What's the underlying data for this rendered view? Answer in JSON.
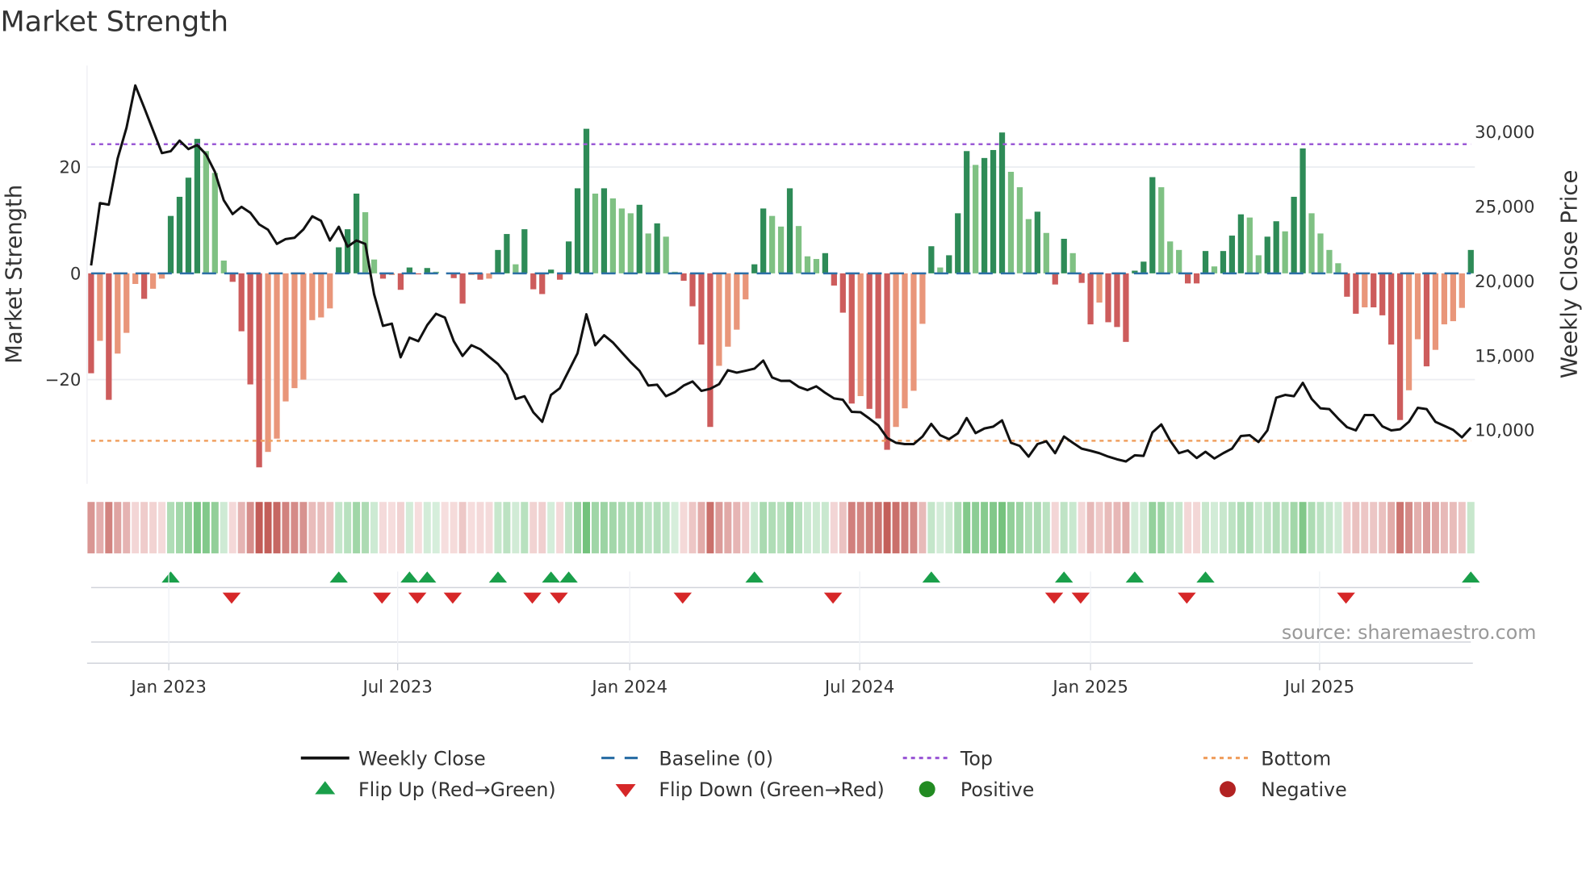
{
  "chart_data": {
    "type": "bar",
    "title": "Market Strength",
    "ylabel": "Market Strength",
    "y2label": "Weekly Close Price",
    "ylim": [
      -39.6,
      39.1
    ],
    "y2lim": [
      6400,
      34460
    ],
    "yticks": [
      {
        "value": 20,
        "label": "20"
      },
      {
        "value": 0,
        "label": "0"
      },
      {
        "value": -20,
        "label": "−20"
      }
    ],
    "y2ticks": [
      {
        "value": 30000,
        "label": "30,000"
      },
      {
        "value": 25000,
        "label": "25,000"
      },
      {
        "value": 20000,
        "label": "20,000"
      },
      {
        "value": 15000,
        "label": "15,000"
      },
      {
        "value": 10000,
        "label": "10,000"
      }
    ],
    "xticks": [
      {
        "week": 8.78,
        "label": "Jan 2023"
      },
      {
        "week": 34.66,
        "label": "Jul 2023"
      },
      {
        "week": 60.9,
        "label": "Jan 2024"
      },
      {
        "week": 86.9,
        "label": "Jul 2024"
      },
      {
        "week": 113.0,
        "label": "Jan 2025"
      },
      {
        "week": 138.9,
        "label": "Jul 2025"
      }
    ],
    "top_level": 24.3,
    "bottom_level": -31.5,
    "strength": [
      -18.8,
      -12.7,
      -23.8,
      -15.1,
      -11.2,
      -2.0,
      -4.8,
      -2.9,
      -1.0,
      10.8,
      14.4,
      18.0,
      25.3,
      23.0,
      18.9,
      2.4,
      -1.6,
      -10.9,
      -20.9,
      -36.5,
      -33.6,
      -31.1,
      -24.1,
      -21.6,
      -20.0,
      -8.8,
      -8.3,
      -6.6,
      4.9,
      8.3,
      15.0,
      11.5,
      2.6,
      -1.0,
      -0.3,
      -3.1,
      1.1,
      -0.2,
      1.0,
      0.3,
      0.0,
      -0.9,
      -5.7,
      -0.3,
      -1.2,
      -1.0,
      4.4,
      7.4,
      1.7,
      8.3,
      -3.0,
      -3.9,
      0.7,
      -1.2,
      6.0,
      16.0,
      27.2,
      15.0,
      16.0,
      14.1,
      12.2,
      11.3,
      12.9,
      7.5,
      9.4,
      6.9,
      0.3,
      -1.4,
      -6.2,
      -13.4,
      -28.9,
      -17.4,
      -13.8,
      -10.6,
      -4.9,
      1.7,
      12.2,
      10.8,
      8.8,
      16.0,
      8.9,
      3.2,
      2.7,
      3.8,
      -2.3,
      -7.4,
      -24.5,
      -23.1,
      -25.5,
      -27.3,
      -33.2,
      -28.9,
      -25.4,
      -22.1,
      -9.5,
      5.1,
      1.1,
      3.4,
      11.3,
      23.0,
      20.4,
      21.7,
      23.2,
      26.5,
      19.1,
      16.2,
      10.2,
      11.6,
      7.6,
      -2.1,
      6.5,
      3.8,
      -1.8,
      -9.6,
      -5.5,
      -9.2,
      -10.1,
      -12.9,
      0.5,
      2.2,
      18.1,
      16.2,
      6.0,
      4.4,
      -1.9,
      -1.9,
      4.2,
      1.3,
      4.2,
      7.1,
      11.1,
      10.5,
      3.4,
      6.9,
      9.8,
      7.9,
      14.4,
      23.5,
      11.3,
      7.5,
      4.4,
      1.9,
      -4.4,
      -7.6,
      -6.4,
      -6.4,
      -7.9,
      -13.4,
      -27.6,
      -22.0,
      -12.4,
      -17.5,
      -14.4,
      -9.6,
      -9.0,
      -6.5,
      4.4
    ],
    "weekly_close": [
      21048,
      25230,
      25122,
      28224,
      30291,
      33123,
      31643,
      30115,
      28582,
      28710,
      29426,
      28852,
      29122,
      28494,
      27320,
      25426,
      24494,
      24980,
      24582,
      23806,
      23447,
      22494,
      22818,
      22906,
      23467,
      24345,
      24042,
      22723,
      23642,
      22311,
      22723,
      22494,
      19121,
      16994,
      17142,
      14885,
      16203,
      15966,
      17047,
      17804,
      17554,
      15966,
      14980,
      15696,
      15426,
      14926,
      14439,
      13716,
      12095,
      12277,
      11196,
      10561,
      12365,
      12818,
      13987,
      15156,
      17770,
      15696,
      16365,
      15879,
      15210,
      14561,
      13987,
      12995,
      13049,
      12277,
      12547,
      12995,
      13264,
      12635,
      12777,
      13088,
      14020,
      13858,
      13987,
      14128,
      14669,
      13534,
      13304,
      13311,
      12906,
      12689,
      12939,
      12507,
      12128,
      12041,
      11230,
      11204,
      10777,
      10331,
      9480,
      9155,
      9067,
      9067,
      9574,
      10419,
      9662,
      9392,
      9790,
      10818,
      9804,
      10115,
      10236,
      10655,
      9155,
      8939,
      8223,
      9067,
      9250,
      8453,
      9574,
      9155,
      8763,
      8615,
      8453,
      8223,
      8040,
      7899,
      8311,
      8275,
      9845,
      10385,
      9304,
      8453,
      8635,
      8128,
      8547,
      8095,
      8453,
      8763,
      9608,
      9662,
      9209,
      9986,
      12183,
      12365,
      12277,
      13176,
      12095,
      11466,
      11412,
      10777,
      10203,
      9986,
      11014,
      11014,
      10257,
      9986,
      10061,
      10561,
      11500,
      11412,
      10561,
      10291,
      10020,
      9520,
      10169
    ],
    "flip_up_weeks": [
      9,
      28,
      36,
      38,
      46,
      52,
      54,
      75,
      95,
      110,
      118,
      126,
      156
    ],
    "flip_down_weeks": [
      16,
      33,
      37,
      41,
      50,
      53,
      67,
      84,
      109,
      112,
      124,
      142
    ],
    "legend": [
      {
        "key": "close",
        "label": "Weekly Close"
      },
      {
        "key": "baseline",
        "label": "Baseline (0)"
      },
      {
        "key": "top",
        "label": "Top"
      },
      {
        "key": "bottom",
        "label": "Bottom"
      },
      {
        "key": "flipup",
        "label": "Flip Up (Red→Green)"
      },
      {
        "key": "flipdown",
        "label": "Flip Down (Green→Red)"
      },
      {
        "key": "positive",
        "label": "Positive"
      },
      {
        "key": "negative",
        "label": "Negative"
      }
    ],
    "legend_placement": "bottom",
    "source": "source: sharemaestro.com"
  },
  "colors": {
    "pos_dark": "#2e8b57",
    "pos_light": "#7fc183",
    "neg_dark": "#cd5c5c",
    "neg_light": "#e9967a",
    "close": "#111111",
    "baseline": "#2c6fa6",
    "top": "#9b59d6",
    "bottom": "#f0a060",
    "flip_up": "#1a9f4a",
    "flip_down": "#d62728",
    "positive": "#228b22",
    "negative": "#b22222"
  }
}
